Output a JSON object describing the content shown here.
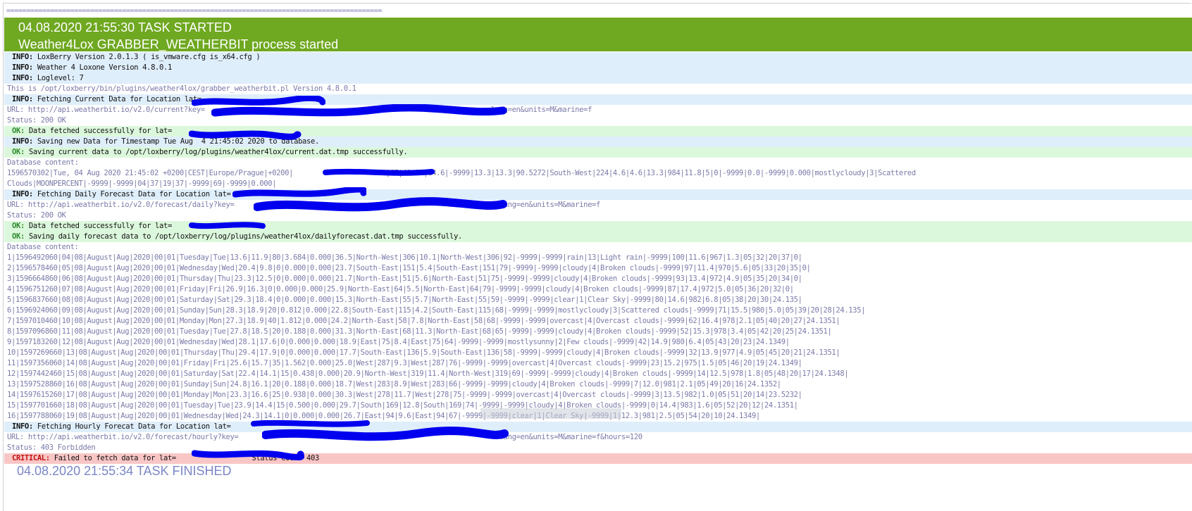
{
  "separator": "==============================================================================================",
  "header": {
    "task_started": "04.08.2020 21:55:30 TASK STARTED",
    "process_started": "Weather4Lox GRABBER_WEATHERBIT process started"
  },
  "log": [
    {
      "type": "info",
      "tag": "INFO:",
      "text": " LoxBerry Version 2.0.1.3 ( is_vmware.cfg is_x64.cfg )"
    },
    {
      "type": "info",
      "tag": "INFO:",
      "text": " Weather 4 Loxone Version 4.8.0.1"
    },
    {
      "type": "info",
      "tag": "INFO:",
      "text": " Loglevel: 7"
    },
    {
      "type": "plain",
      "tag": "",
      "text": "This is /opt/loxberry/bin/plugins/weather4lox/grabber_weatherbit.pl Version 4.8.0.1"
    },
    {
      "type": "info",
      "tag": "INFO:",
      "text": " Fetching Current Data for Location lat="
    },
    {
      "type": "plain",
      "tag": "",
      "text": "URL: http://api.weatherbit.io/v2.0/current?key=                                                                    lang=en&units=M&marine=f"
    },
    {
      "type": "plain",
      "tag": "",
      "text": "Status: 200 OK"
    },
    {
      "type": "ok",
      "tag": "OK:",
      "text": " Data fetched successfully for lat="
    },
    {
      "type": "info",
      "tag": "INFO:",
      "text": " Saving new Data for Timestamp Tue Aug  4 21:45:02 2020 to database."
    },
    {
      "type": "ok",
      "tag": "OK:",
      "text": " Saving current data to /opt/loxberry/log/plugins/weather4lox/current.dat.tmp successfully."
    },
    {
      "type": "plain",
      "tag": "",
      "text": "Database content:"
    },
    {
      "type": "plain",
      "tag": "",
      "text": "1596570302|Tue, 04 Aug 2020 21:45:02 +0200|CEST|Europe/Prague|+0200|                      |CZ|49.96|14.6|-9999|13.3|13.3|90.5272|South-West|224|4.6|4.6|13.3|984|11.8|5|0|-9999|0.0|-9999|0.000|mostlycloudy|3|Scattered"
    },
    {
      "type": "plain",
      "tag": "",
      "text": "Clouds|MOONPERCENT|-9999|-9999|04|37|19|37|-9999|69|-9999|0.000|"
    },
    {
      "type": "info",
      "tag": "INFO:",
      "text": " Fetching Daily Forecast Data for Location lat="
    },
    {
      "type": "plain",
      "tag": "",
      "text": "URL: http://api.weatherbit.io/v2.0/forecast/daily?key=                                                               lang=en&units=M&marine=f"
    },
    {
      "type": "plain",
      "tag": "",
      "text": "Status: 200 OK"
    },
    {
      "type": "ok",
      "tag": "OK:",
      "text": " Data fetched successfully for lat="
    },
    {
      "type": "ok",
      "tag": "OK:",
      "text": " Saving daily forecast data to /opt/loxberry/log/plugins/weather4lox/dailyforecast.dat.tmp successfully."
    },
    {
      "type": "plain",
      "tag": "",
      "text": "Database content:"
    },
    {
      "type": "plain",
      "tag": "",
      "text": "1|1596492060|04|08|August|Aug|2020|00|01|Tuesday|Tue|13.6|11.9|80|3.684|0.000|36.5|North-West|306|10.1|North-West|306|92|-9999|-9999|rain|13|Light rain|-9999|100|11.6|967|1.3|05|32|20|37|0|"
    },
    {
      "type": "plain",
      "tag": "",
      "text": "2|1596578460|05|08|August|Aug|2020|00|01|Wednesday|Wed|20.4|9.8|0|0.000|0.000|23.7|South-East|151|5.4|South-East|151|79|-9999|-9999|cloudy|4|Broken clouds|-9999|97|11.4|970|5.6|05|33|20|35|0|"
    },
    {
      "type": "plain",
      "tag": "",
      "text": "3|1596664860|06|08|August|Aug|2020|00|01|Thursday|Thu|23.3|12.5|0|0.000|0.000|21.7|North-East|51|5.6|North-East|51|75|-9999|-9999|cloudy|4|Broken clouds|-9999|93|13.4|972|4.9|05|35|20|34|0|"
    },
    {
      "type": "plain",
      "tag": "",
      "text": "4|1596751260|07|08|August|Aug|2020|00|01|Friday|Fri|26.9|16.3|0|0.000|0.000|25.9|North-East|64|5.5|North-East|64|79|-9999|-9999|cloudy|4|Broken clouds|-9999|87|17.4|972|5.0|05|36|20|32|0|"
    },
    {
      "type": "plain",
      "tag": "",
      "text": "5|1596837660|08|08|August|Aug|2020|00|01|Saturday|Sat|29.3|18.4|0|0.000|0.000|15.3|North-East|55|5.7|North-East|55|59|-9999|-9999|clear|1|Clear Sky|-9999|80|14.6|982|6.8|05|38|20|30|24.135|"
    },
    {
      "type": "plain",
      "tag": "",
      "text": "6|1596924060|09|08|August|Aug|2020|00|01|Sunday|Sun|28.3|18.9|20|0.812|0.000|22.8|South-East|115|4.2|South-East|115|68|-9999|-9999|mostlycloudy|3|Scattered clouds|-9999|71|15.5|980|5.0|05|39|20|28|24.135|"
    },
    {
      "type": "plain",
      "tag": "",
      "text": "7|1597010460|10|08|August|Aug|2020|00|01|Monday|Mon|27.3|18.9|40|1.812|0.000|24.2|North-East|58|7.8|North-East|58|68|-9999|-9999|overcast|4|Overcast clouds|-9999|62|16.4|978|2.1|05|40|20|27|24.1351|"
    },
    {
      "type": "plain",
      "tag": "",
      "text": "8|1597096860|11|08|August|Aug|2020|00|01|Tuesday|Tue|27.8|18.5|20|0.188|0.000|31.3|North-East|68|11.3|North-East|68|65|-9999|-9999|cloudy|4|Broken clouds|-9999|52|15.3|978|3.4|05|42|20|25|24.1351|"
    },
    {
      "type": "plain",
      "tag": "",
      "text": "9|1597183260|12|08|August|Aug|2020|00|01|Wednesday|Wed|28.1|17.6|0|0.000|0.000|18.9|East|75|8.4|East|75|64|-9999|-9999|mostlysunny|2|Few clouds|-9999|42|14.9|980|6.4|05|43|20|23|24.1349|"
    },
    {
      "type": "plain",
      "tag": "",
      "text": "10|1597269660|13|08|August|Aug|2020|00|01|Thursday|Thu|29.4|17.9|0|0.000|0.000|17.7|South-East|136|5.9|South-East|136|58|-9999|-9999|cloudy|4|Broken clouds|-9999|32|13.9|977|4.9|05|45|20|21|24.1351|"
    },
    {
      "type": "plain",
      "tag": "",
      "text": "11|1597356060|14|08|August|Aug|2020|00|01|Friday|Fri|25.6|15.7|35|1.562|0.000|25.0|West|287|9.3|West|287|76|-9999|-9999|overcast|4|Overcast clouds|-9999|23|15.2|975|1.5|05|46|20|19|24.1349|"
    },
    {
      "type": "plain",
      "tag": "",
      "text": "12|1597442460|15|08|August|Aug|2020|00|01|Saturday|Sat|22.4|14.1|15|0.438|0.000|20.9|North-West|319|11.4|North-West|319|69|-9999|-9999|cloudy|4|Broken clouds|-9999|14|12.5|978|1.8|05|48|20|17|24.1348|"
    },
    {
      "type": "plain",
      "tag": "",
      "text": "13|1597528860|16|08|August|Aug|2020|00|01|Sunday|Sun|24.8|16.1|20|0.188|0.000|18.7|West|283|8.9|West|283|66|-9999|-9999|cloudy|4|Broken clouds|-9999|7|12.0|981|2.1|05|49|20|16|24.1352|"
    },
    {
      "type": "plain",
      "tag": "",
      "text": "14|1597615260|17|08|August|Aug|2020|00|01|Monday|Mon|23.3|16.6|25|0.938|0.000|30.3|West|278|11.7|West|278|75|-9999|-9999|overcast|4|Overcast clouds|-9999|3|13.5|982|1.0|05|51|20|14|23.5232|"
    },
    {
      "type": "plain",
      "tag": "",
      "text": "15|1597701660|18|08|August|Aug|2020|00|01|Tuesday|Tue|23.9|14.4|15|0.500|0.000|29.7|South|169|12.8|South|169|74|-9999|-9999|cloudy|4|Broken clouds|-9999|0|14.4|983|1.6|05|52|20|12|24.1351|"
    },
    {
      "type": "plain",
      "tag": "",
      "text": "16|1597788060|19|08|August|Aug|2020|00|01|Wednesday|Wed|24.3|14.1|0|0.000|0.000|26.7|East|94|9.6|East|94|67|-9999|-9999|clear|1|Clear Sky|-9999|1|12.3|981|2.5|05|54|20|10|24.1349|"
    },
    {
      "type": "info",
      "tag": "INFO:",
      "text": " Fetching Hourly Forecat Data for Location lat="
    },
    {
      "type": "plain",
      "tag": "",
      "text": "URL: http://api.weatherbit.io/v2.0/forecast/hourly?key=                                                              lang=en&units=M&marine=f&hours=120"
    },
    {
      "type": "plain",
      "tag": "",
      "text": "Status: 403 Forbidden"
    },
    {
      "type": "crit",
      "tag": "CRITICAL:",
      "text": " Failed to fetch data for lat=                  Status Code: 403"
    }
  ],
  "footer": {
    "task_finished": "04.08.2020 21:55:34 TASK FINISHED"
  },
  "colors": {
    "banner": "#6fa821",
    "info_bg": "#dfeefb",
    "ok_bg": "#dcf8dc",
    "crit_bg": "#f9c6c6",
    "plain_text": "#7a7aaa",
    "redaction": "#0000ee"
  }
}
